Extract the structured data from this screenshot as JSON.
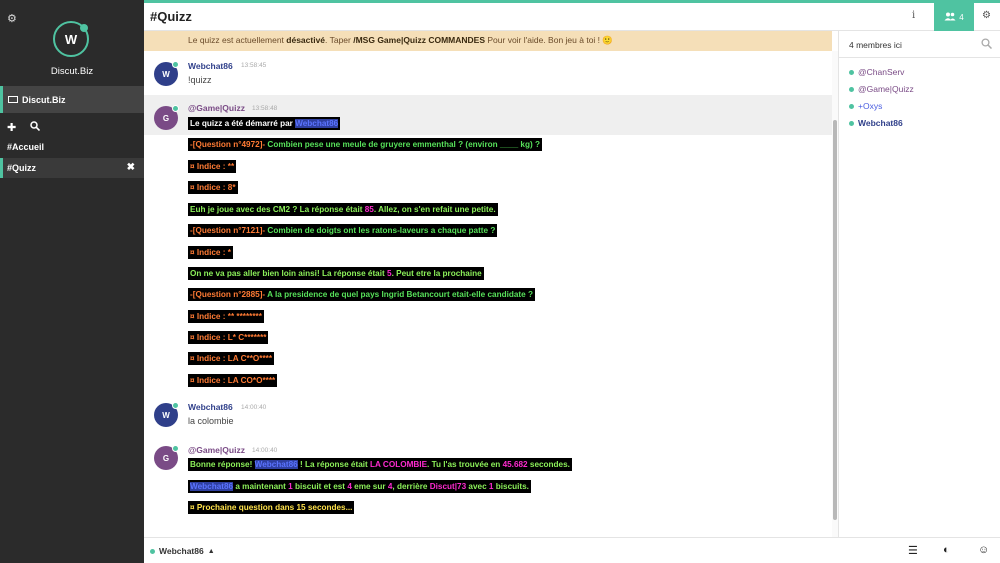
{
  "sidebar": {
    "settings_icon": "gear-icon",
    "avatar_letter": "W",
    "server_name": "Discut.Biz",
    "network_label": "Discut.Biz",
    "channels": [
      {
        "label": "#Accueil"
      },
      {
        "label": "#Quizz",
        "close": "✖"
      }
    ]
  },
  "header": {
    "channel": "#Quizz",
    "info_icon": "i",
    "user_count": "4"
  },
  "topic": {
    "p1": "Le quizz est actuellement ",
    "state": "désactivé",
    "p2": ". Taper ",
    "cmd": "/MSG Game|Quizz COMMANDES",
    "p3": " Pour voir l'aide. Bon jeu à toi ! ",
    "emoji": "🙂"
  },
  "messages": {
    "m1": {
      "avatar": "W",
      "nick": "Webchat86",
      "time": "13:58:45",
      "text": "!quizz"
    },
    "m2": {
      "avatar": "G",
      "nick": "@Game|Quizz",
      "time": "13:58:48",
      "l1a": "Le quizz a été démarré par ",
      "l1b": "Webchat86",
      "l2a": "-[Question n°4972]-",
      "l2b": " Combien pese une meule de gruyere emmenthal ? (environ ____ kg) ?",
      "l3": "¤ Indice : **",
      "l4": "¤ Indice : 8*",
      "l5a": "Euh je joue avec des CM2 ? La réponse était ",
      "l5b": "85",
      "l5c": ". Allez, on s'en refait une petite.",
      "l6a": "-[Question n°7121]-",
      "l6b": " Combien de doigts ont les ratons-laveurs a chaque patte ?",
      "l7": "¤ Indice : *",
      "l8a": "On ne va pas aller bien loin ainsi! La réponse était ",
      "l8b": "5",
      "l8c": ". Peut etre la prochaine",
      "l9a": "-[Question n°2885]-",
      "l9b": " A la presidence de quel pays Ingrid Betancourt etait-elle candidate ?",
      "l10": "¤ Indice : ** ********",
      "l11": "¤ Indice : L* C*******",
      "l12": "¤ Indice : LA C**O****",
      "l13": "¤ Indice : LA CO*O****"
    },
    "m3": {
      "avatar": "W",
      "nick": "Webchat86",
      "time": "14:00:40",
      "text": "la colombie"
    },
    "m4": {
      "avatar": "G",
      "nick": "@Game|Quizz",
      "time": "14:00:40",
      "l1a": "Bonne réponse! ",
      "l1b": "Webchat86",
      "l1c": " ! La réponse était ",
      "l1d": "LA COLOMBIE",
      "l1e": ". Tu l'as trouvée en ",
      "l1f": "45.682",
      "l1g": " secondes.",
      "l2a": "Webchat86",
      "l2b": " a maintenant ",
      "l2c": "1",
      "l2d": " biscuit et est ",
      "l2e": "4",
      "l2f": " eme sur ",
      "l2g": "4",
      "l2h": ", derrière ",
      "l2i": "Discut|73",
      "l2j": " avec ",
      "l2k": "1",
      "l2l": " biscuits.",
      "l3": "¤ Prochaine question dans 15 secondes..."
    }
  },
  "userlist": {
    "count_label": "4 membres ici",
    "users": [
      {
        "name": "@ChanServ",
        "color": "#7a4b86"
      },
      {
        "name": "@Game|Quizz",
        "color": "#7a4b86"
      },
      {
        "name": "+Oxys",
        "color": "#4a5de0"
      },
      {
        "name": "Webchat86",
        "color": "#2f3f8a"
      }
    ]
  },
  "footer": {
    "nick": "Webchat86",
    "caret": "▲",
    "menu_icon": "☰",
    "contrast_icon": "◐",
    "emoji_icon": "☺"
  },
  "colors": {
    "accent": "#4fc3a1",
    "topic_bg": "#f5dfb8"
  }
}
